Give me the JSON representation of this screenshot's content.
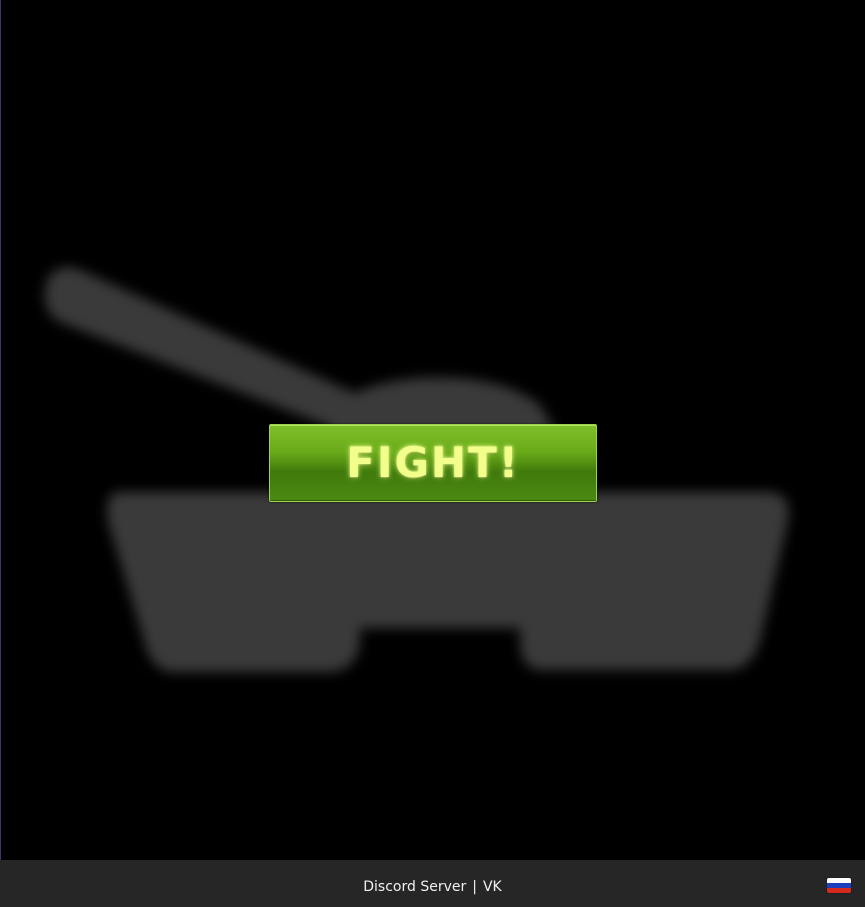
{
  "main": {
    "play_button_label": "FIGHT!"
  },
  "footer": {
    "discord_label": "Discord Server",
    "separator": "|",
    "vk_label": "VK",
    "language_flag_icon": "russia-flag-icon"
  },
  "colors": {
    "background": "#000000",
    "tank_silhouette": "#3a3a3a",
    "button_green": "#5a9a18",
    "button_text": "#f2ff8a",
    "footer_background": "#262626",
    "footer_text": "#f0f0f0"
  }
}
